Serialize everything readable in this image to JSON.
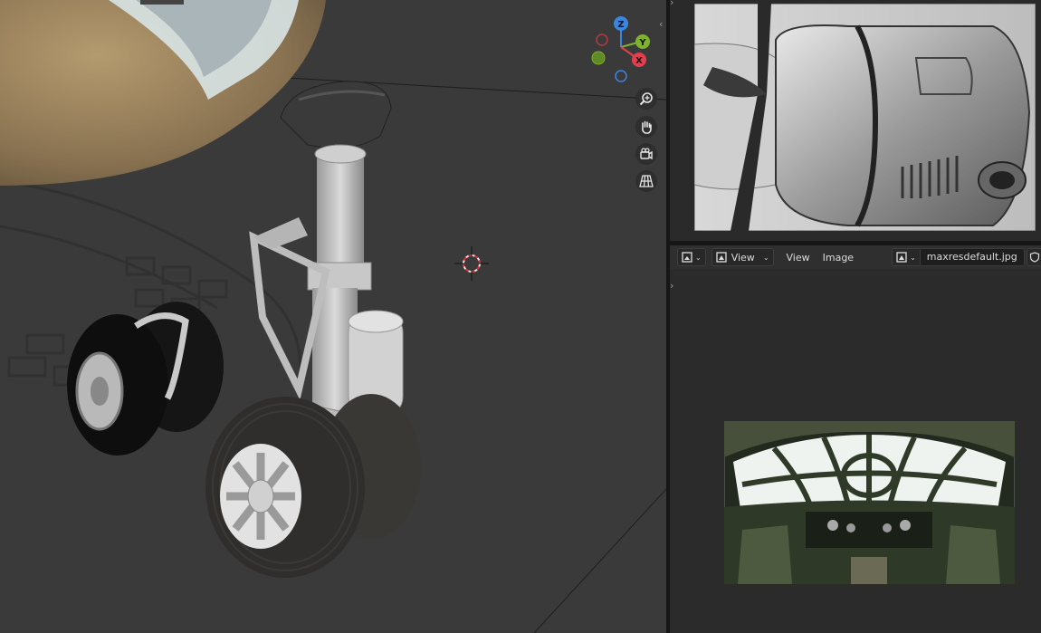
{
  "image_editor": {
    "view_menu_dropdown": "View",
    "menu_view": "View",
    "menu_image": "Image",
    "image_name": "maxresdefault.jpg"
  },
  "gizmo": {
    "axis_z": "Z",
    "axis_y": "Y",
    "axis_x": "X"
  },
  "colors": {
    "viewport_bg": "#3a3a3a",
    "axis_x": "#e2404f",
    "axis_y": "#7fb32d",
    "axis_z": "#3b86e0"
  },
  "icons": [
    "zoom-icon",
    "hand-icon",
    "camera-icon",
    "grid-icon",
    "image-type-icon",
    "shield-icon",
    "copy-icon"
  ]
}
